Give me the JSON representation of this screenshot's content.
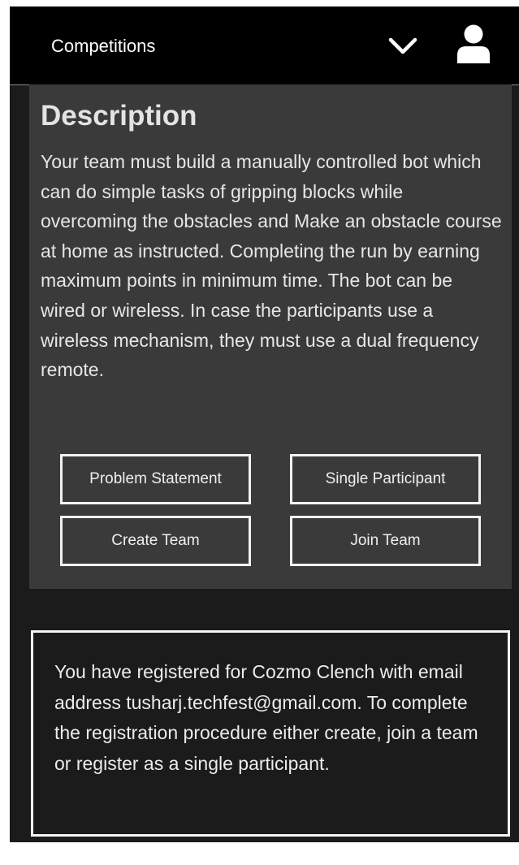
{
  "nav": {
    "title": "Competitions",
    "dropdown_icon": "chevron-down-icon",
    "account_icon": "user-icon"
  },
  "description": {
    "heading": "Description",
    "text": "Your team must build a manually controlled bot which can do simple tasks of gripping blocks while overcoming the obstacles and Make an obstacle course at home as instructed. Completing the run by earning maximum points in minimum time. The bot can be wired or wireless. In case the participants use a wireless mechanism, they must use a dual frequency remote."
  },
  "actions": {
    "problem_statement": "Problem Statement",
    "single_participant": "Single Participant",
    "create_team": "Create Team",
    "join_team": "Join Team"
  },
  "notice": {
    "text": "You have registered for Cozmo Clench with email address tusharj.techfest@gmail.com. To complete the registration procedure either create, join a team or register as a single participant."
  },
  "colors": {
    "topbar": "#000000",
    "background": "#1b1b1b",
    "card": "#3a3a3a",
    "text": "#e6e6e6",
    "border": "#f2f2f2"
  }
}
